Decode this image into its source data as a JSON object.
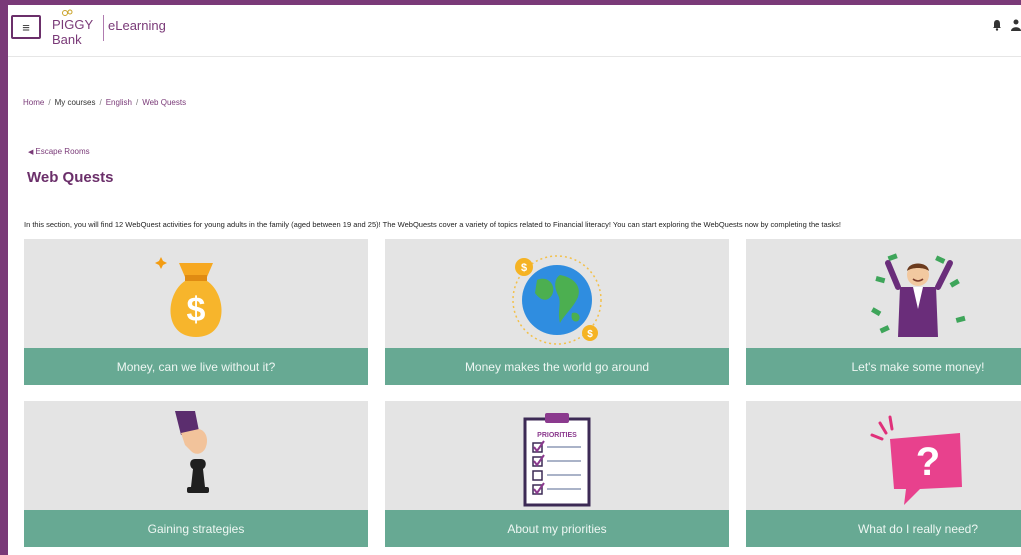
{
  "header": {
    "logo_line1": "PIGGY",
    "logo_line2": "Bank",
    "brand": "eLearning",
    "menu_icon": "hamburger-icon",
    "notifications_icon": "bell-icon",
    "user_icon": "user-icon"
  },
  "breadcrumb": {
    "items": [
      "Home",
      "My courses",
      "English",
      "Web Quests"
    ],
    "separator": "/"
  },
  "back_link": {
    "arrow": "◀",
    "label": "Escape Rooms"
  },
  "page_title": "Web Quests",
  "intro": "In this section, you will find 12 WebQuest activities for young adults in the family (aged between 19 and 25)! The WebQuests cover a variety of topics related to Financial literacy! You can start exploring the WebQuests now by completing the tasks!",
  "cards": [
    {
      "title": "Money, can we live without it?",
      "icon": "money-bag-icon"
    },
    {
      "title": "Money makes the world go around",
      "icon": "globe-coins-icon"
    },
    {
      "title": "Let's make some money!",
      "icon": "man-money-rain-icon"
    },
    {
      "title": "Gaining strategies",
      "icon": "chess-hand-icon"
    },
    {
      "title": "About my priorities",
      "icon": "priorities-clipboard-icon",
      "icon_text": "PRIORITIES"
    },
    {
      "title": "What do I really need?",
      "icon": "question-bubble-icon",
      "icon_text": "?"
    }
  ],
  "colors": {
    "frame": "#7a3a78",
    "accent": "#6b2f6a",
    "card_bar": "#67a993",
    "card_bg": "#e4e4e4"
  }
}
